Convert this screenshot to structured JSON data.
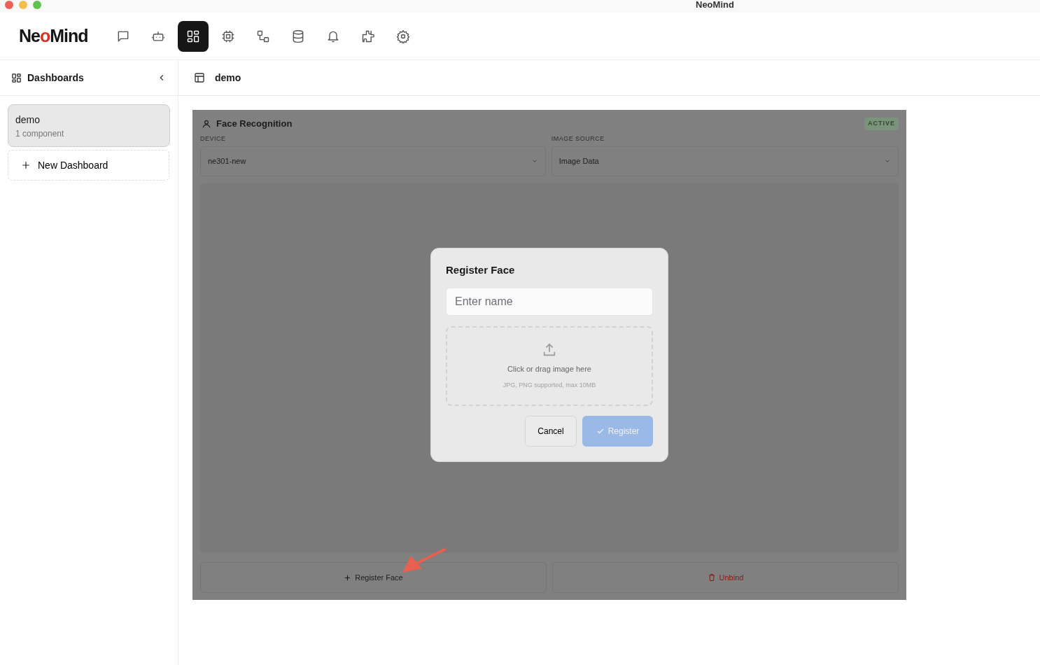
{
  "window": {
    "title": "NeoMind"
  },
  "logo": "NeoMind",
  "nav": [
    {
      "kind": "chat",
      "selected": false
    },
    {
      "kind": "bot",
      "selected": false
    },
    {
      "kind": "dashboard",
      "selected": true
    },
    {
      "kind": "chip",
      "selected": false
    },
    {
      "kind": "flow",
      "selected": false
    },
    {
      "kind": "database",
      "selected": false
    },
    {
      "kind": "bell",
      "selected": false
    },
    {
      "kind": "puzzle",
      "selected": false
    },
    {
      "kind": "gear",
      "selected": false
    }
  ],
  "sidebar": {
    "title": "Dashboards",
    "items": [
      {
        "name": "demo",
        "subtitle": "1 component",
        "selected": true
      }
    ],
    "new_button": "New Dashboard"
  },
  "header": {
    "title": "demo"
  },
  "component": {
    "title": "Face Recognition",
    "badge": "ACTIVE",
    "fields": [
      {
        "label": "DEVICE",
        "value": "ne301-new"
      },
      {
        "label": "IMAGE SOURCE",
        "value": "Image Data"
      }
    ],
    "buttons": [
      {
        "kind": "register",
        "label": "Register Face"
      },
      {
        "kind": "unbind",
        "label": "Unbind"
      }
    ]
  },
  "dialog": {
    "title": "Register Face",
    "name_field": {
      "placeholder": "Enter name"
    },
    "upload": {
      "text": "Click or drag image here",
      "hint": "JPG, PNG supported, max 10MB"
    },
    "cancel": "Cancel",
    "confirm": {
      "label": "Register",
      "disabled": true
    }
  }
}
